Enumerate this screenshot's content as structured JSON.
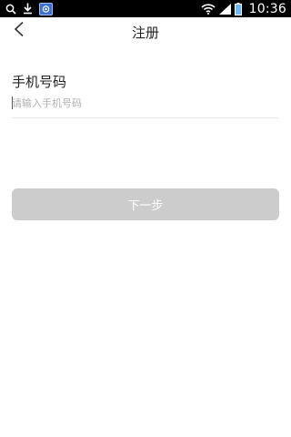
{
  "status_bar": {
    "time": "10:36",
    "icons": [
      "search-icon",
      "download-icon",
      "app-icon",
      "wifi-icon",
      "signal-icon",
      "battery-icon"
    ]
  },
  "header": {
    "title": "注册",
    "back_icon": "chevron-left-icon"
  },
  "form": {
    "phone_label": "手机号码",
    "phone_placeholder": "请输入手机号码",
    "phone_value": ""
  },
  "actions": {
    "next_label": "下一步"
  },
  "colors": {
    "status_bar_bg": "#000000",
    "button_disabled_bg": "#cccccc",
    "button_text": "#ffffff",
    "divider": "#e6e6e6"
  }
}
